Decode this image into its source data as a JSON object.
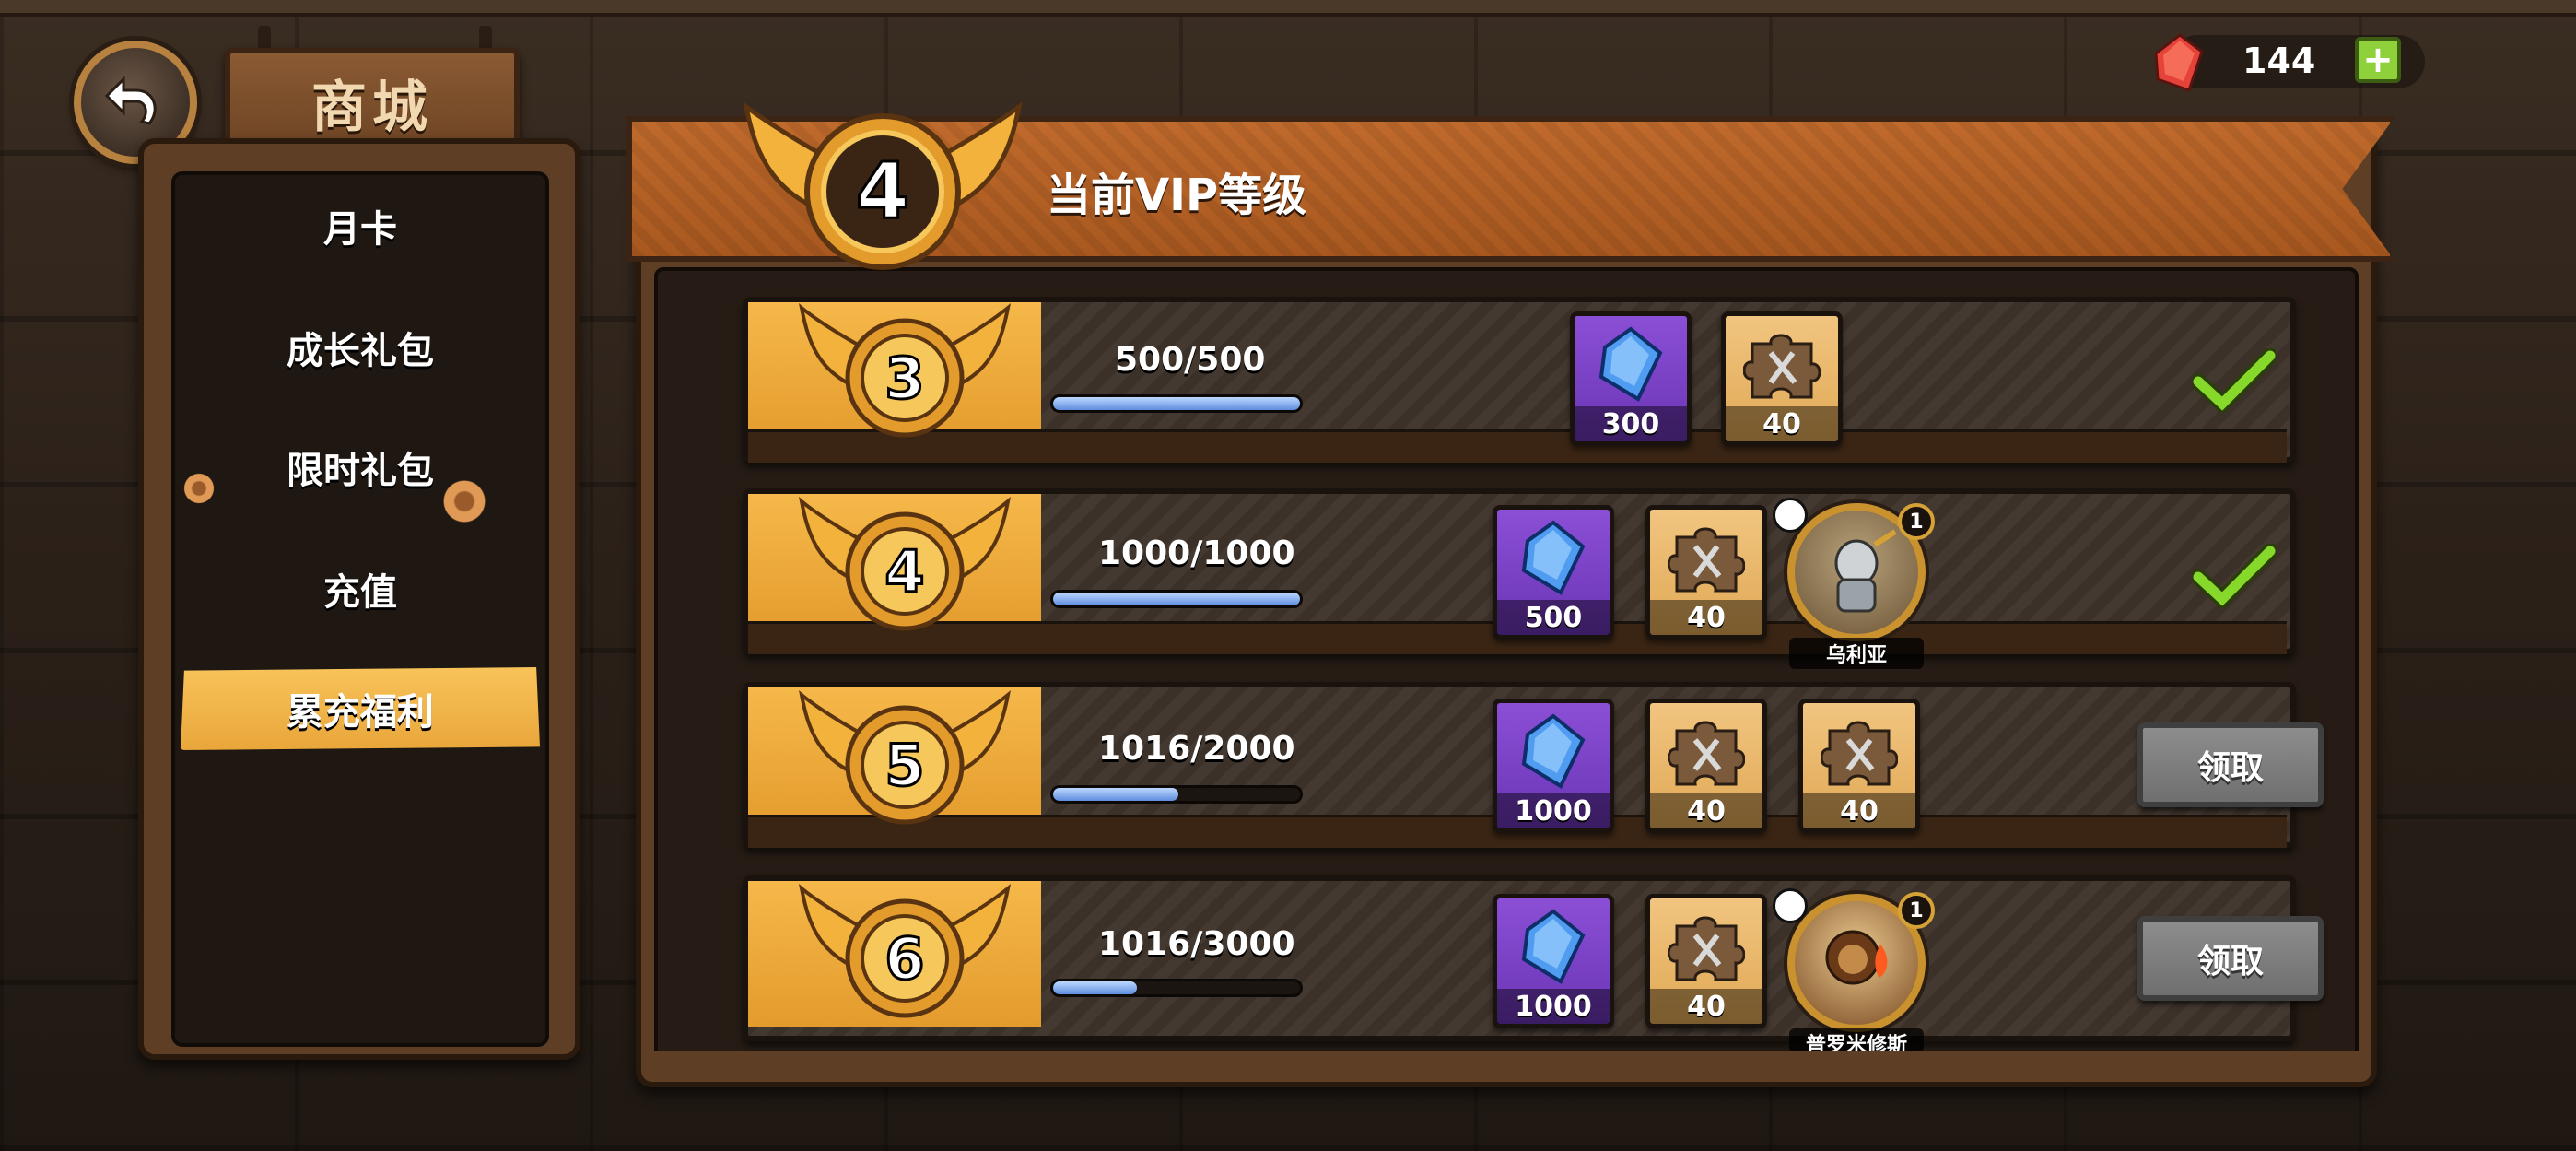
{
  "header": {
    "shop_title": "商城",
    "currency": {
      "value": "144",
      "add_label": "+"
    },
    "vip_banner": {
      "level": "4",
      "title": "当前VIP等级"
    }
  },
  "sidebar": {
    "items": [
      {
        "label": "月卡",
        "active": false
      },
      {
        "label": "成长礼包",
        "active": false
      },
      {
        "label": "限时礼包",
        "active": false
      },
      {
        "label": "充值",
        "active": false
      },
      {
        "label": "累充福利",
        "active": true
      }
    ]
  },
  "rows": [
    {
      "level": "3",
      "progress_text": "500/500",
      "progress": 1.0,
      "rewards": [
        {
          "type": "gem",
          "qty": "300"
        },
        {
          "type": "puzzle",
          "qty": "40"
        }
      ],
      "status": "claimed"
    },
    {
      "level": "4",
      "progress_text": "1000/1000",
      "progress": 1.0,
      "rewards": [
        {
          "type": "gem",
          "qty": "500"
        },
        {
          "type": "puzzle",
          "qty": "40"
        }
      ],
      "hero": {
        "name": "乌利亚",
        "badge": "1"
      },
      "status": "claimed"
    },
    {
      "level": "5",
      "progress_text": "1016/2000",
      "progress": 0.508,
      "rewards": [
        {
          "type": "gem",
          "qty": "1000"
        },
        {
          "type": "puzzle",
          "qty": "40"
        },
        {
          "type": "puzzle",
          "qty": "40"
        }
      ],
      "status": "claimable",
      "button_label": "领取"
    },
    {
      "level": "6",
      "progress_text": "1016/3000",
      "progress": 0.339,
      "rewards": [
        {
          "type": "gem",
          "qty": "1000"
        },
        {
          "type": "puzzle",
          "qty": "40"
        }
      ],
      "hero": {
        "name": "普罗米修斯",
        "badge": "1"
      },
      "status": "claimable",
      "button_label": "领取"
    }
  ],
  "colors": {
    "accent_gold": "#f6b84a",
    "gem_purple": "#8b4fd6",
    "check_green": "#7ed321",
    "progress_blue": "#5f8ede"
  }
}
